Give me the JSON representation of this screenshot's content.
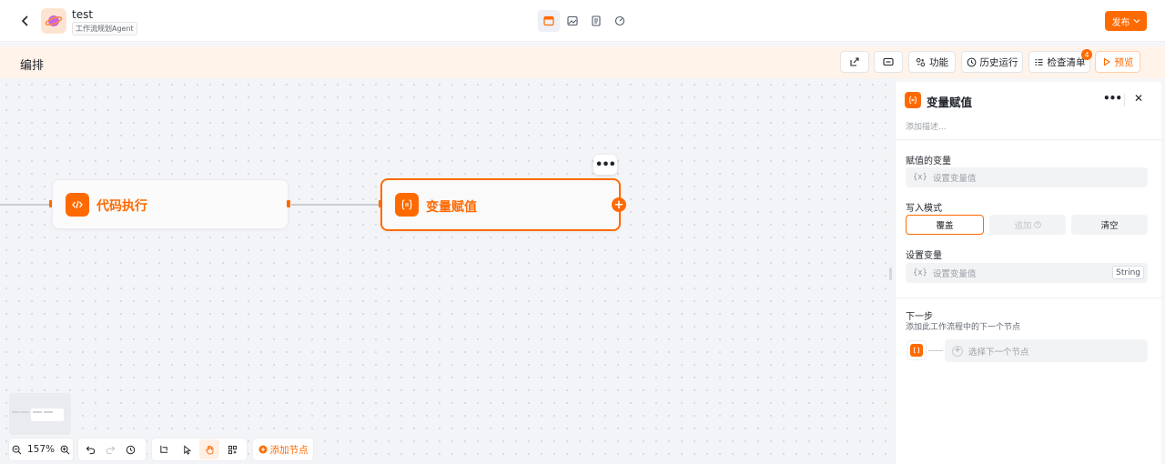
{
  "header": {
    "app_name": "test",
    "app_tag": "工作流规划Agent",
    "publish_label": "发布"
  },
  "subbar": {
    "title": "编排",
    "feature_label": "功能",
    "history_label": "历史运行",
    "checklist_label": "检查清单",
    "checklist_badge": "4",
    "preview_label": "预览"
  },
  "canvas": {
    "nodes": [
      {
        "title": "代码执行",
        "icon": "code-icon"
      },
      {
        "title": "变量赋值",
        "icon": "variable-assign-icon",
        "selected": true
      }
    ],
    "more_label": "•••",
    "zoom": "157%",
    "add_node_label": "添加节点"
  },
  "panel": {
    "title": "变量赋值",
    "description_placeholder": "添加描述...",
    "assigned_var_label": "赋值的变量",
    "assigned_var_placeholder": "设置变量值",
    "var_prefix": "{x}",
    "write_mode_label": "写入模式",
    "modes": [
      "覆盖",
      "追加",
      "清空"
    ],
    "set_var_label": "设置变量",
    "set_var_placeholder": "设置变量值",
    "set_var_type": "String",
    "next_step_label": "下一步",
    "next_step_desc": "添加此工作流程中的下一个节点",
    "next_step_placeholder": "选择下一个节点"
  },
  "colors": {
    "accent": "#ff6a00",
    "canvas_bg": "#f3f4f7"
  }
}
